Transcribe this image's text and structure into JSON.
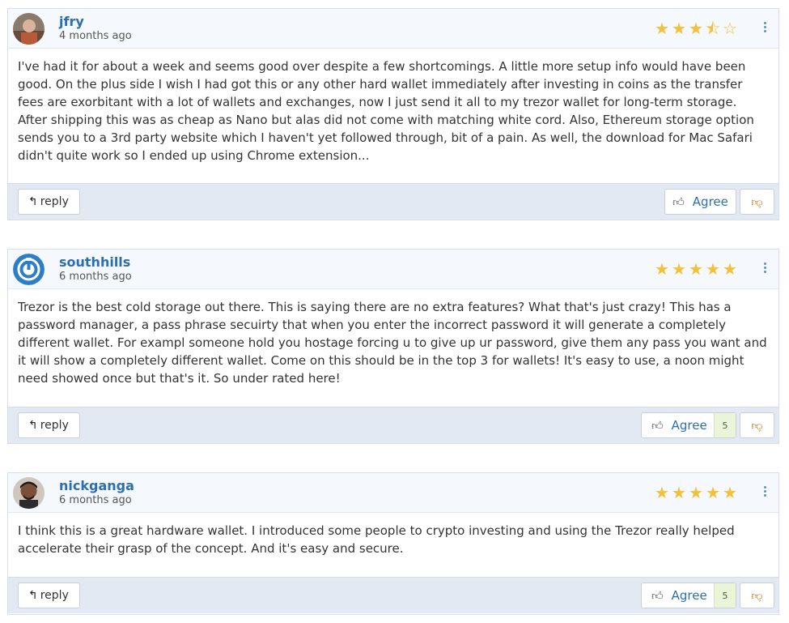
{
  "reviews": [
    {
      "author": "jfry",
      "time": "4 months ago",
      "rating": 3.5,
      "text": "I've had it for about a week and seems good over despite a few shortcomings. A little more setup info would have been good. On the plus side I wish I had got this or any other hard wallet immediately after investing in coins as the transfer fees are exorbitant with a lot of wallets and exchanges, now I just send it all to my trezor wallet for long-term storage. After shipping this was as cheap as Nano but alas did not come with matching white cord. Also, Ethereum storage option sends you to a 3rd party website which I haven't yet followed through, bit of a pain. As well, the download for Mac Safari didn't quite work so I ended up using Chrome extension...",
      "reply_label": "reply",
      "agree_label": "Agree",
      "agree_count": "",
      "avatar": "photo"
    },
    {
      "author": "southhills",
      "time": "6 months ago",
      "rating": 5,
      "text": "Trezor is the best cold storage out there. This is saying there are no extra features? What that's just crazy! This has a password manager, a pass phrase secuirty that when you enter the incorrect password it will generate a completely different wallet. For exampl someone hold you hostage forcing u to give up ur password, give them any pass you want and it will show a completely different wallet. Come on this should be in the top 3 for wallets! It's easy to use, a noon might need showed once but that's it. So under rated here!",
      "reply_label": "reply",
      "agree_label": "Agree",
      "agree_count": "5",
      "avatar": "power-logo"
    },
    {
      "author": "nickganga",
      "time": "6 months ago",
      "rating": 5,
      "text": "I think this is a great hardware wallet. I introduced some people to crypto investing and using the Trezor really helped accelerate their grasp of the concept. And it's easy and secure.",
      "reply_label": "reply",
      "agree_label": "Agree",
      "agree_count": "5",
      "avatar": "photo"
    }
  ],
  "colors": {
    "star": "#f2c13a",
    "author": "#2b6fb0",
    "dislike": "#c27316",
    "agree_count_bg": "#e9f5d6"
  },
  "icons": {
    "reply": "reply-arrow-icon",
    "agree": "thumbs-up-icon",
    "dislike": "thumbs-down-icon",
    "menu": "kebab-menu-icon"
  }
}
